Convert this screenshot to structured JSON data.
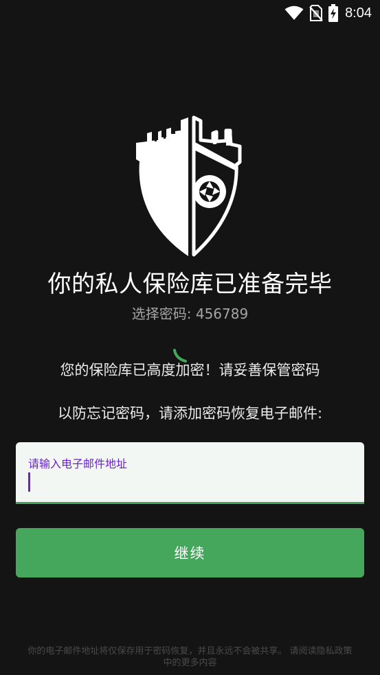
{
  "status_bar": {
    "time": "8:04",
    "icons": [
      "wifi-icon",
      "no-sim-icon",
      "battery-charging-icon"
    ]
  },
  "logo": {
    "icon": "castle-shield-camera-icon"
  },
  "title": "你的私人保险库已准备完毕",
  "subtitle": "选择密码: 456789",
  "spinner": {
    "icon": "loading-spinner-icon"
  },
  "description": {
    "line1": "您的保险库已高度加密！请妥善保管密码",
    "line2": "以防忘记密码，请添加密码恢复电子邮件:"
  },
  "email_field": {
    "label": "请输入电子邮件地址",
    "value": ""
  },
  "continue_button": {
    "label": "继续"
  },
  "footer": {
    "line1": "你的电子邮件地址将仅保存用于密码恢复，并且永远不会被共享。 请阅读隐私政策",
    "line2": "中的更多内容"
  },
  "colors": {
    "background": "#141414",
    "accent_green": "#45a75c",
    "label_purple": "#6a1fd1"
  }
}
